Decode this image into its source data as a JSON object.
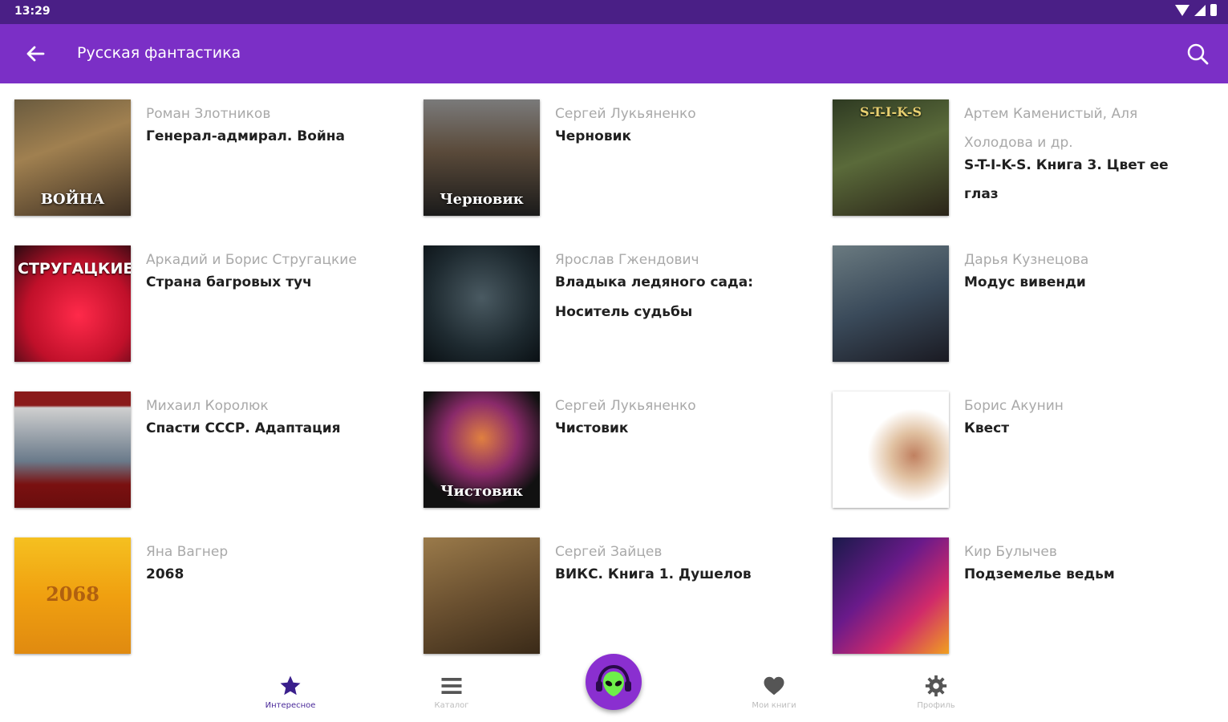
{
  "status_bar": {
    "time": "13:29"
  },
  "app_bar": {
    "title": "Русская фантастика"
  },
  "colors": {
    "app_bar": "#7b2fc6",
    "status_bar": "#4a1f86",
    "fab": "#8a2fd0",
    "nav_active": "#3a1f8c"
  },
  "books": [
    {
      "author": "Роман Злотников",
      "title": "Генерал-адмирал. Война",
      "cover_text": "ВОЙНА",
      "cover_top": ""
    },
    {
      "author": "Сергей Лукьяненко",
      "title": "Черновик",
      "cover_text": "Черновик",
      "cover_top": ""
    },
    {
      "author": "Артем Каменистый, Аля Холодова и др.",
      "title": "S-T-I-K-S. Книга 3. Цвет ее глаз",
      "cover_text": "",
      "cover_top": "S-T-I-K-S"
    },
    {
      "author": "Аркадий и Борис Стругацкие",
      "title": "Страна багровых туч",
      "cover_text": "",
      "cover_top": "СТРУГАЦКИЕ"
    },
    {
      "author": "Ярослав Гжендович",
      "title": "Владыка ледяного сада: Носитель судьбы",
      "cover_text": "",
      "cover_top": ""
    },
    {
      "author": "Дарья Кузнецова",
      "title": "Модус вивенди",
      "cover_text": "",
      "cover_top": ""
    },
    {
      "author": "Михаил Королюк",
      "title": "Спасти СССР. Адаптация",
      "cover_text": "",
      "cover_top": ""
    },
    {
      "author": "Сергей Лукьяненко",
      "title": "Чистовик",
      "cover_text": "Чистовик",
      "cover_top": ""
    },
    {
      "author": "Борис Акунин",
      "title": "Квест",
      "cover_text": "",
      "cover_top": ""
    },
    {
      "author": "Яна Вагнер",
      "title": "2068",
      "cover_text": "2068",
      "cover_top": ""
    },
    {
      "author": "Сергей Зайцев",
      "title": "ВИКС. Книга 1. Душелов",
      "cover_text": "",
      "cover_top": ""
    },
    {
      "author": "Кир Булычев",
      "title": "Подземелье ведьм",
      "cover_text": "",
      "cover_top": ""
    }
  ],
  "nav": {
    "interesting": "Интересное",
    "catalog": "Каталог",
    "my_books": "Мои книги",
    "profile": "Профиль"
  }
}
